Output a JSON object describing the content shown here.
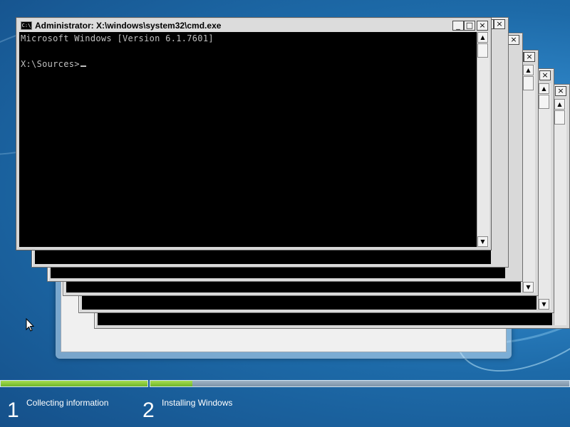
{
  "window": {
    "title": "Administrator: X:\\windows\\system32\\cmd.exe",
    "icon_label": "C:\\",
    "minimize_glyph": "_",
    "maximize_glyph": "□",
    "close_glyph": "×"
  },
  "console": {
    "lines": [
      "Microsoft Windows [Version 6.1.7601]",
      "",
      "X:\\Sources>"
    ]
  },
  "scrollbar": {
    "up_arrow": "▲",
    "down_arrow": "▼"
  },
  "setup_steps": [
    {
      "number": "1",
      "label": "Collecting information"
    },
    {
      "number": "2",
      "label": "Installing Windows"
    }
  ],
  "progress": {
    "collecting_information": 1.0,
    "installing_windows": 0.1
  },
  "colors": {
    "console_background": "#000000",
    "console_text": "#c0c0c0",
    "progress_fill": "#7cc232",
    "desktop_blue": "#1d6aa8"
  }
}
